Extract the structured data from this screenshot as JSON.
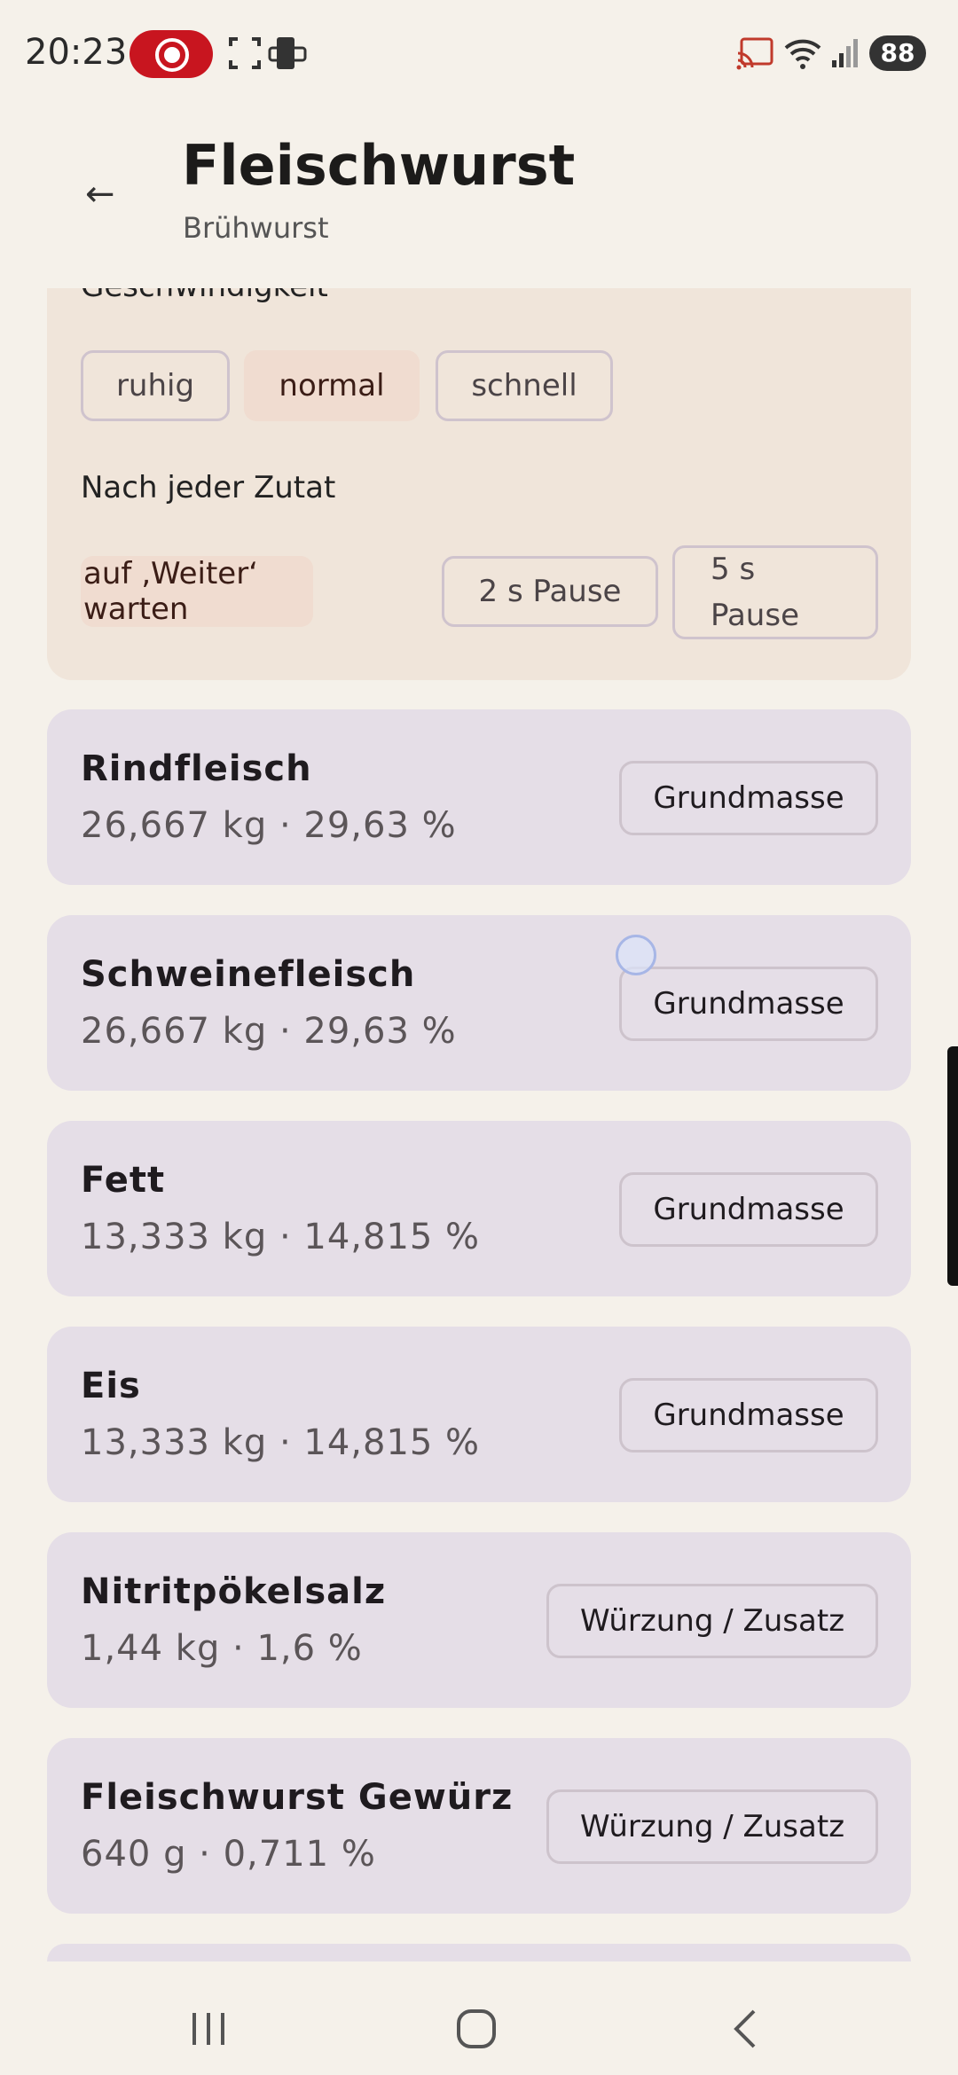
{
  "status_bar": {
    "time": "20:23",
    "battery": "88"
  },
  "header": {
    "back_label": "←",
    "title": "Fleischwurst",
    "subtitle": "Brühwurst"
  },
  "settings": {
    "speed_label": "Geschwindigkeit",
    "speed_options": [
      "ruhig",
      "normal",
      "schnell"
    ],
    "speed_selected": "normal",
    "after_label": "Nach jeder Zutat",
    "after_options": [
      "auf ‚Weiter‘ warten",
      "2 s Pause",
      "5 s\nPause"
    ],
    "after_selected": "auf ‚Weiter‘ warten"
  },
  "ingredients": [
    {
      "name": "Rindfleisch",
      "amount": "26,667 kg  ·  29,63 %",
      "category": "Grundmasse"
    },
    {
      "name": "Schweinefleisch",
      "amount": "26,667 kg  ·  29,63 %",
      "category": "Grundmasse"
    },
    {
      "name": "Fett",
      "amount": "13,333 kg  ·  14,815 %",
      "category": "Grundmasse"
    },
    {
      "name": "Eis",
      "amount": "13,333 kg  ·  14,815 %",
      "category": "Grundmasse"
    },
    {
      "name": "Nitritpökelsalz",
      "amount": "1,44 kg  ·  1,6 %",
      "category": "Würzung / Zusatz"
    },
    {
      "name": "Fleischwurst Gewürz",
      "amount": "640 g  ·  0,711 %",
      "category": "Würzung / Zusatz"
    }
  ]
}
